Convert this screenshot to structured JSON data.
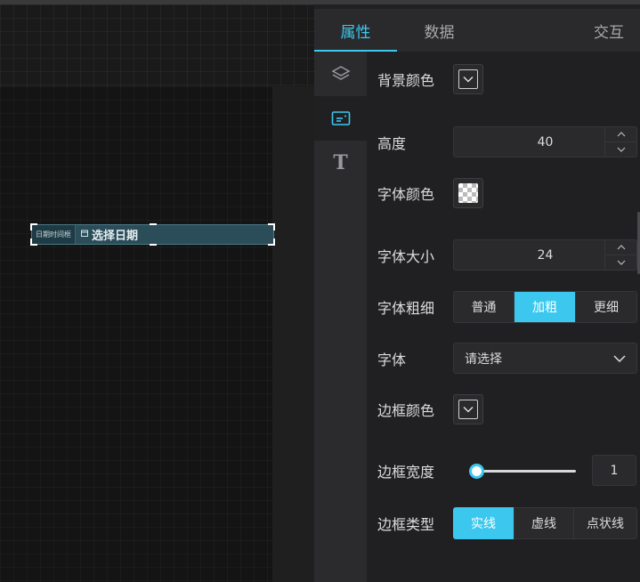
{
  "tabs": [
    {
      "label": "属性",
      "active": true
    },
    {
      "label": "数据",
      "active": false
    },
    {
      "label": "交互",
      "active": false
    }
  ],
  "sidebar": {
    "items": [
      {
        "icon": "layers-icon",
        "active": false
      },
      {
        "icon": "component-card-icon",
        "active": true
      },
      {
        "icon": "text-icon",
        "glyph": "T",
        "active": false
      }
    ]
  },
  "widget": {
    "tag": "日期时间框",
    "text": "选择日期"
  },
  "props": {
    "bg_color_label": "背景颜色",
    "height_label": "高度",
    "height_value": "40",
    "font_color_label": "字体颜色",
    "font_size_label": "字体大小",
    "font_size_value": "24",
    "font_weight_label": "字体粗细",
    "font_weight_options": [
      "普通",
      "加粗",
      "更细"
    ],
    "font_weight_selected": "加粗",
    "font_family_label": "字体",
    "font_family_placeholder": "请选择",
    "border_color_label": "边框颜色",
    "border_width_label": "边框宽度",
    "border_width_value": "1",
    "border_width_fraction": 0.0,
    "border_type_label": "边框类型",
    "border_type_options": [
      "实线",
      "虚线",
      "点状线"
    ],
    "border_type_selected": "实线"
  },
  "colors": {
    "accent": "#3cc8ee",
    "panel_bg": "#202022",
    "widget_bg": "#2a4d59"
  }
}
